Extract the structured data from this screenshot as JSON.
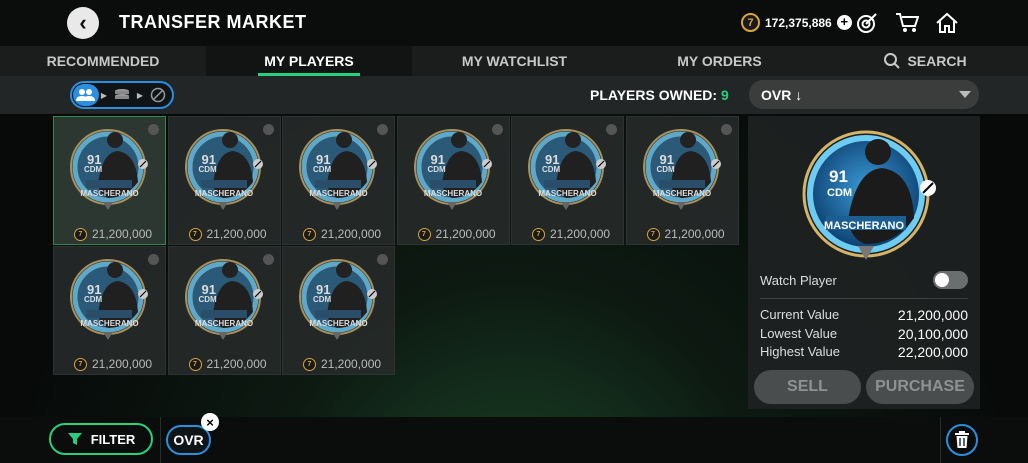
{
  "header": {
    "title": "TRANSFER MARKET",
    "back_icon": "back-arrow-icon",
    "coins": "172,375,886",
    "coin_symbol": "7",
    "icons": [
      "plus-icon",
      "objectives-target-icon",
      "shopping-cart-icon",
      "home-icon"
    ]
  },
  "tabs": [
    {
      "label": "RECOMMENDED",
      "active": false
    },
    {
      "label": "MY PLAYERS",
      "active": true
    },
    {
      "label": "MY WATCHLIST",
      "active": false
    },
    {
      "label": "MY ORDERS",
      "active": false
    },
    {
      "label": "SEARCH",
      "active": false
    }
  ],
  "subbar": {
    "owned_label": "PLAYERS OWNED:",
    "owned_count": "9",
    "sort_value": "OVR ↓"
  },
  "cards": [
    {
      "ovr": "91",
      "pos": "CDM",
      "name": "MASCHERANO",
      "price": "21,200,000",
      "selected": true
    },
    {
      "ovr": "91",
      "pos": "CDM",
      "name": "MASCHERANO",
      "price": "21,200,000",
      "selected": false
    },
    {
      "ovr": "91",
      "pos": "CDM",
      "name": "MASCHERANO",
      "price": "21,200,000",
      "selected": false
    },
    {
      "ovr": "91",
      "pos": "CDM",
      "name": "MASCHERANO",
      "price": "21,200,000",
      "selected": false
    },
    {
      "ovr": "91",
      "pos": "CDM",
      "name": "MASCHERANO",
      "price": "21,200,000",
      "selected": false
    },
    {
      "ovr": "91",
      "pos": "CDM",
      "name": "MASCHERANO",
      "price": "21,200,000",
      "selected": false
    },
    {
      "ovr": "91",
      "pos": "CDM",
      "name": "MASCHERANO",
      "price": "21,200,000",
      "selected": false
    },
    {
      "ovr": "91",
      "pos": "CDM",
      "name": "MASCHERANO",
      "price": "21,200,000",
      "selected": false
    },
    {
      "ovr": "91",
      "pos": "CDM",
      "name": "MASCHERANO",
      "price": "21,200,000",
      "selected": false
    }
  ],
  "detail": {
    "ovr": "91",
    "pos": "CDM",
    "name": "MASCHERANO",
    "watch_label": "Watch Player",
    "values": [
      {
        "label": "Current Value",
        "value": "21,200,000"
      },
      {
        "label": "Lowest Value",
        "value": "20,100,000"
      },
      {
        "label": "Highest Value",
        "value": "22,200,000"
      }
    ],
    "sell_label": "SELL",
    "purchase_label": "PURCHASE"
  },
  "bottom": {
    "filter_label": "FILTER",
    "chip_label": "OVR",
    "trash_icon": "trash-icon"
  },
  "colors": {
    "accent_green": "#26d07c",
    "accent_blue": "#2b8fe0",
    "coin_gold": "#d7a63a"
  }
}
